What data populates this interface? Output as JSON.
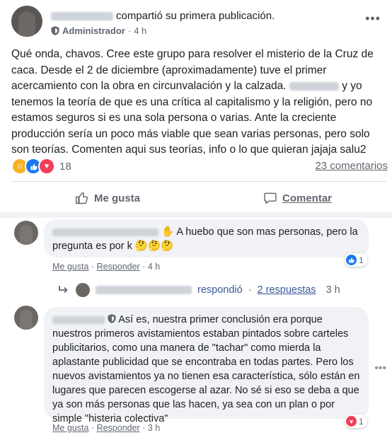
{
  "post": {
    "action_text": "compartió su primera publicación.",
    "role": "Administrador",
    "time": "4 h",
    "body_part1": "Qué onda, chavos. Cree este grupo para resolver el misterio de la Cruz de caca. Desde el 2 de diciembre (aproximadamente) tuve el primer acercamiento con la obra en circunvalación y la calzada.",
    "body_part2": "y yo tenemos la teoría de que es una crítica al capitalismo y la religión, pero no estamos seguros si es una sola persona o varias. Ante la creciente producción sería un poco más viable que sean varias personas, pero solo son teorías. Comenten aqui sus teorías, info o lo que quieran jajaja salu2",
    "reaction_count": "18",
    "comments_count": "23 comentarios",
    "like_label": "Me gusta",
    "comment_label": "Comentar"
  },
  "comments": [
    {
      "text_part1": "A huebo que son mas personas, pero la",
      "text_part2": "pregunta es por k",
      "emojis": "🤔🤔🤔",
      "like_label": "Me gusta",
      "reply_label": "Responder",
      "time": "4 h",
      "reaction_count": "1",
      "replies": {
        "replied_text": "respondió",
        "replies_count": "2 respuestas",
        "time": "3 h"
      }
    },
    {
      "text_part1": "Así es, nuestra primer conclusión era porque",
      "text_rest": "nuestros primeros avistamientos estaban pintados sobre carteles publicitarios, como una manera de \"tachar\" como mierda la aplastante publicidad que se encontraba en todas partes. Pero los nuevos avistamientos ya no tienen esa característica, sólo están en lugares que parecen escogerse al azar. No sé si eso se deba a que ya son más personas que las hacen, ya sea con un plan o por simple \"histeria colectiva\"",
      "like_label": "Me gusta",
      "reply_label": "Responder",
      "time": "3 h",
      "reaction_count": "1"
    }
  ],
  "icons": {
    "more": "more-options-icon",
    "admin": "shield-icon",
    "like": "thumbs-up-icon",
    "comment": "speech-bubble-icon",
    "reply": "reply-arrow-icon",
    "wave": "waving-hand-icon"
  },
  "colors": {
    "like_blue": "#1877f2",
    "love_red": "#f33e58",
    "haha_yellow": "#f7b125",
    "link": "#385898"
  }
}
